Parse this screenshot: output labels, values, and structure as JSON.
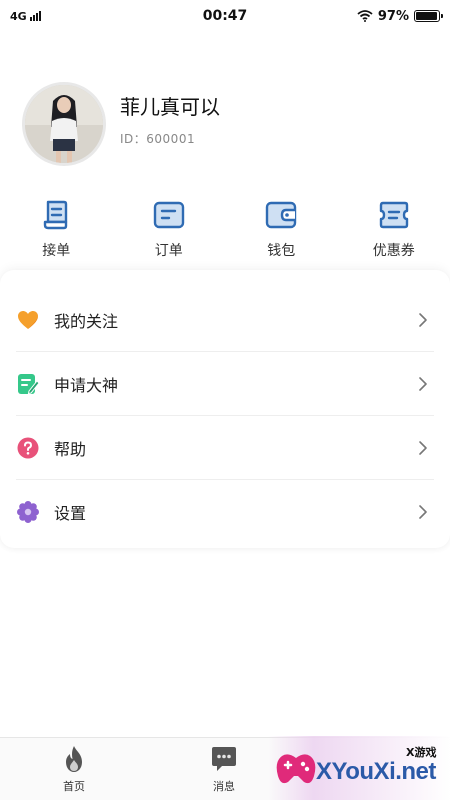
{
  "status_bar": {
    "network": "4G",
    "time": "00:47",
    "battery_percent": "97%",
    "battery_level": 0.97
  },
  "profile": {
    "nickname": "菲儿真可以",
    "user_id": "ID：600001"
  },
  "quick_actions": [
    {
      "label": "接单",
      "icon": "receive-order-icon"
    },
    {
      "label": "订单",
      "icon": "order-icon"
    },
    {
      "label": "钱包",
      "icon": "wallet-icon"
    },
    {
      "label": "优惠券",
      "icon": "coupon-icon"
    }
  ],
  "menu": [
    {
      "label": "我的关注",
      "icon": "heart-icon",
      "color": "#f5a02c"
    },
    {
      "label": "申请大神",
      "icon": "edit-note-icon",
      "color": "#35c88a"
    },
    {
      "label": "帮助",
      "icon": "help-icon",
      "color": "#e8527a"
    },
    {
      "label": "设置",
      "icon": "gear-icon",
      "color": "#8e62d0"
    }
  ],
  "tab_bar": [
    {
      "label": "首页",
      "icon": "flame-icon"
    },
    {
      "label": "消息",
      "icon": "message-icon"
    }
  ],
  "watermark": {
    "text": "XYouXi.net",
    "tag": "X游戏"
  },
  "colors": {
    "accent_blue": "#2f6bb3",
    "divider": "#eeeeee"
  }
}
